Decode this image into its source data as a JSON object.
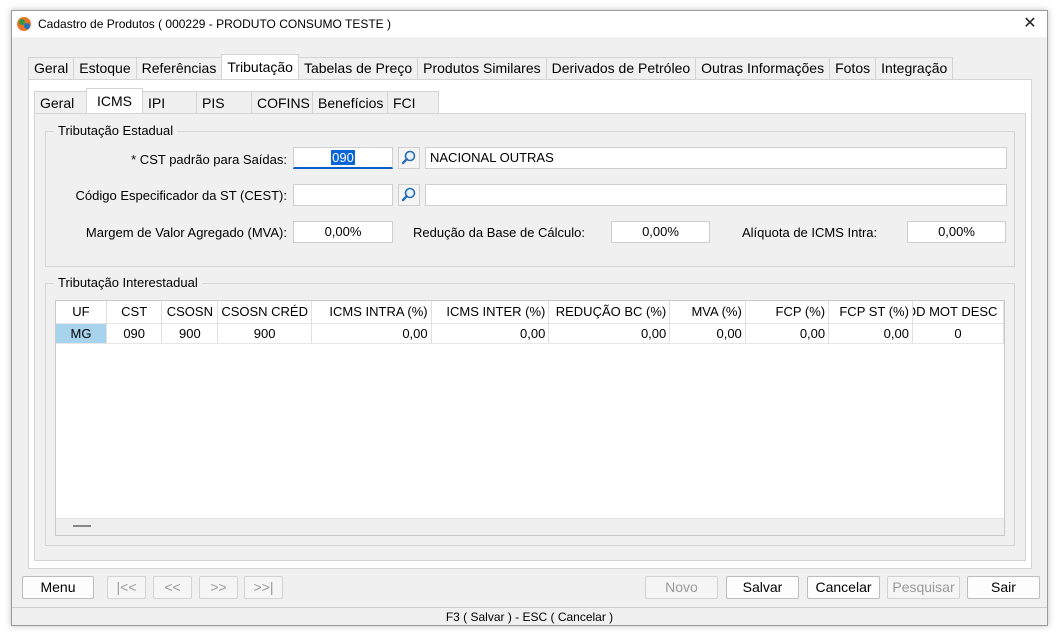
{
  "window": {
    "title": "Cadastro de Produtos ( 000229 - PRODUTO CONSUMO TESTE )",
    "close_glyph": "✕",
    "app_icon": "app-logo-icon"
  },
  "outer_tabs": [
    "Geral",
    "Estoque",
    "Referências",
    "Tributação",
    "Tabelas de Preço",
    "Produtos Similares",
    "Derivados de Petróleo",
    "Outras Informações",
    "Fotos",
    "Integração"
  ],
  "outer_active": "Tributação",
  "inner_tabs": [
    "Geral",
    "ICMS",
    "IPI",
    "PIS",
    "COFINS",
    "Benefícios",
    "FCI"
  ],
  "inner_active": "ICMS",
  "estadual": {
    "title": "Tributação Estadual",
    "cst_label": "* CST padrão para Saídas:",
    "cst_value": "090",
    "cst_description": "NACIONAL OUTRAS",
    "cest_label": "Código Especificador da ST (CEST):",
    "cest_value": "",
    "cest_description": "",
    "mva_label": "Margem de Valor Agregado (MVA):",
    "mva_value": "0,00%",
    "reducao_label": "Redução da Base de Cálculo:",
    "reducao_value": "0,00%",
    "aliquota_label": "Alíquota de ICMS Intra:",
    "aliquota_value": "0,00%"
  },
  "interestadual": {
    "title": "Tributação Interestadual",
    "columns": [
      "UF",
      "CST",
      "CSOSN",
      "CSOSN CRÉD",
      "ICMS INTRA (%)",
      "ICMS INTER (%)",
      "REDUÇÃO BC (%)",
      "MVA (%)",
      "FCP (%)",
      "FCP ST (%)",
      "OD MOT DESC"
    ],
    "rows": [
      [
        "MG",
        "090",
        "900",
        "900",
        "0,00",
        "0,00",
        "0,00",
        "0,00",
        "0,00",
        "0,00",
        "0"
      ]
    ]
  },
  "buttons": {
    "menu": "Menu",
    "first": "|<<",
    "prev": "<<",
    "next": ">>",
    "last": ">>|",
    "novo": "Novo",
    "salvar": "Salvar",
    "cancelar": "Cancelar",
    "pesquisar": "Pesquisar",
    "sair": "Sair"
  },
  "status_text": "F3 ( Salvar )  -  ESC ( Cancelar )",
  "colors": {
    "selection": "#0a66d6",
    "uf_cell": "#a8d3ec",
    "focus_underline": "#0a5ec9"
  }
}
